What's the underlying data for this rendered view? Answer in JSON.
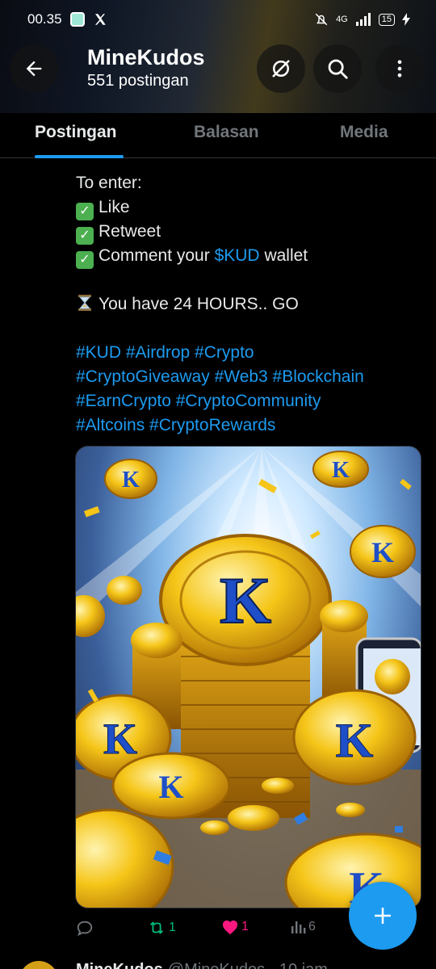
{
  "status_bar": {
    "time": "00.35",
    "network": "4G",
    "battery": "15"
  },
  "header": {
    "name": "MineKudos",
    "post_count": "551 postingan"
  },
  "tabs": [
    {
      "label": "Postingan",
      "active": true
    },
    {
      "label": "Balasan",
      "active": false
    },
    {
      "label": "Media",
      "active": false
    }
  ],
  "tweet": {
    "enter_heading": "To enter:",
    "steps": {
      "like": "Like",
      "retweet": "Retweet",
      "comment_prefix": "Comment your",
      "comment_cashtag": "$KUD",
      "comment_suffix": "wallet"
    },
    "deadline": "You have 24 HOURS.. GO",
    "hashtags": {
      "line1": "#KUD #Airdrop #Crypto",
      "line2": "#CryptoGiveaway #Web3 #Blockchain",
      "line3": "#EarnCrypto #CryptoCommunity",
      "line4": "#Altcoins #CryptoRewards"
    },
    "coin_letter": "K",
    "stats": {
      "replies": "",
      "retweets": "1",
      "likes": "1",
      "views": "6"
    }
  },
  "next_tweet": {
    "name": "MineKudos",
    "handle": "@MineKudos · 10 jam"
  },
  "colors": {
    "accent": "#1d9bf0",
    "retweet": "#00ba7c",
    "like": "#f91880",
    "muted": "#71767b"
  },
  "icons": [
    "back-arrow-icon",
    "grok-icon",
    "search-icon",
    "more-vertical-icon",
    "reply-icon",
    "retweet-icon",
    "heart-icon",
    "views-icon",
    "plus-icon"
  ]
}
